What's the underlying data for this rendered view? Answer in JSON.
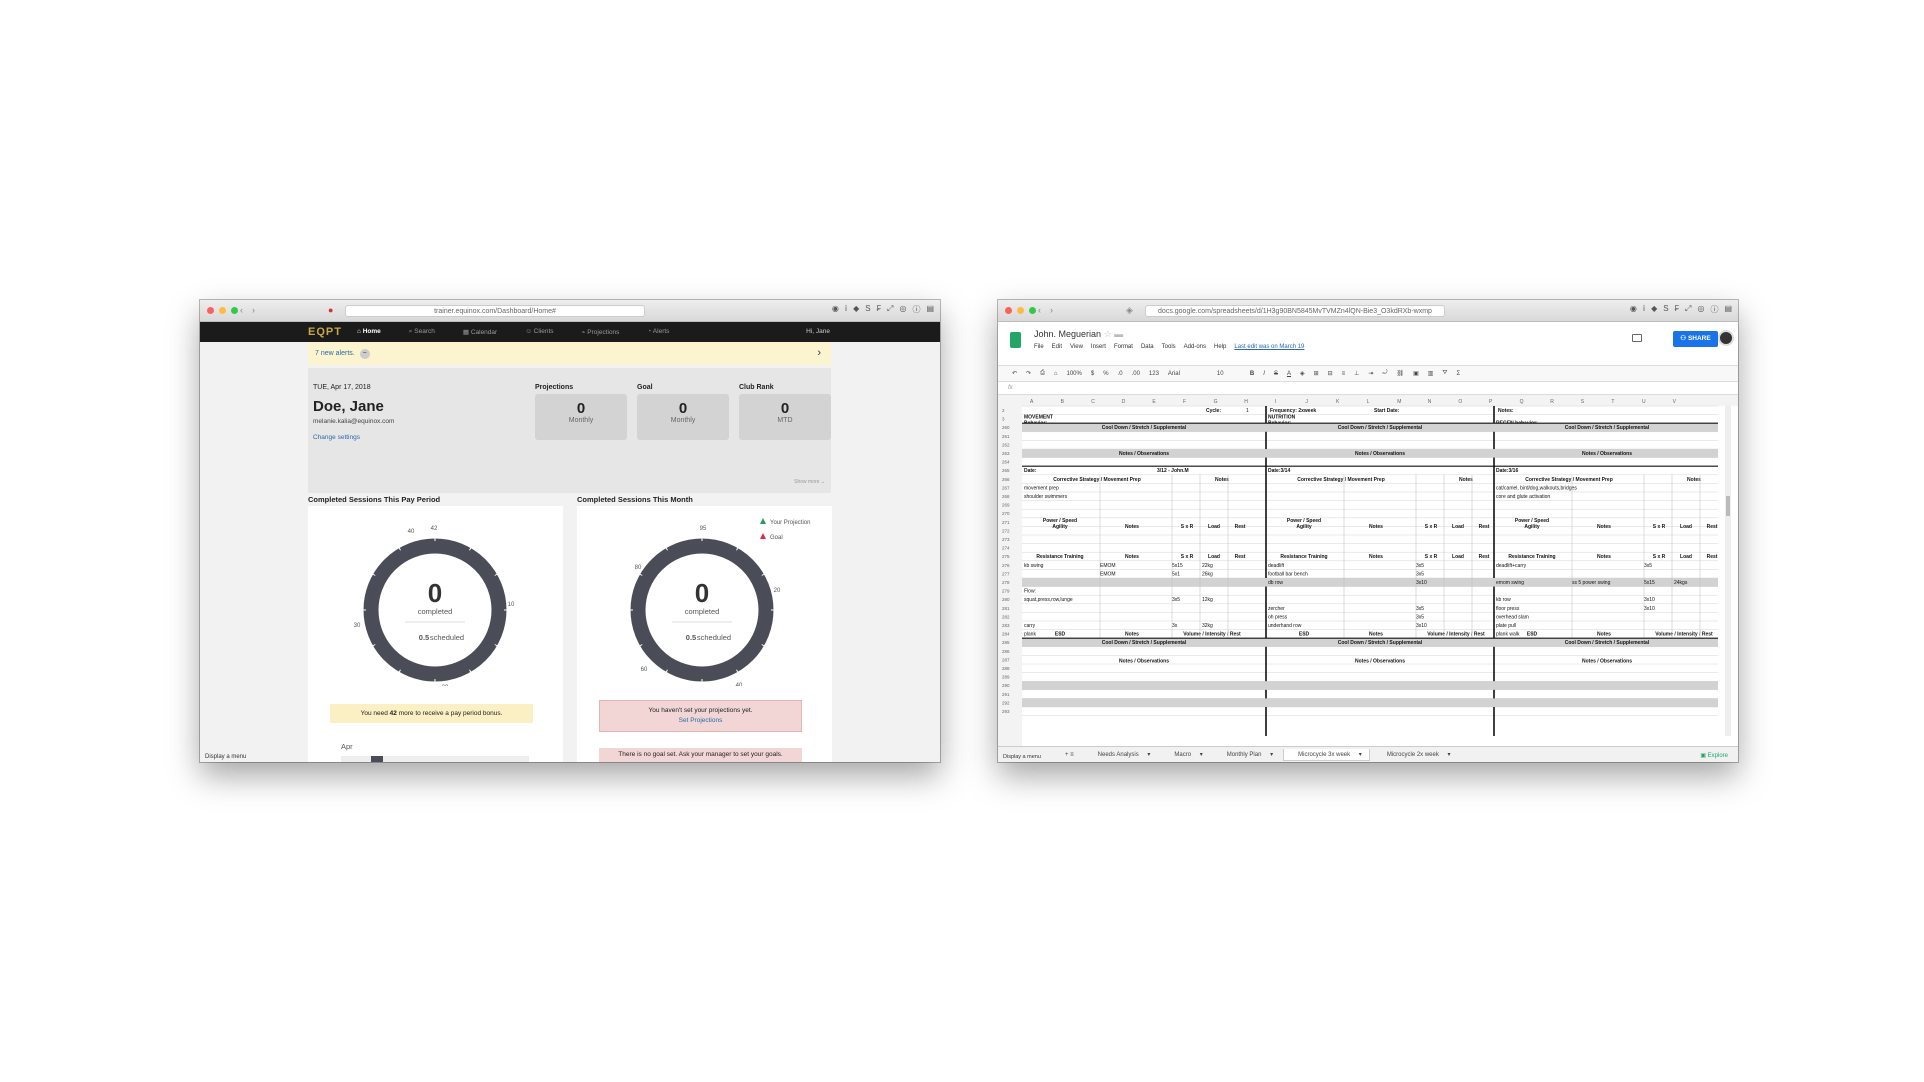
{
  "left_window": {
    "url": "trainer.equinox.com/Dashboard/Home#",
    "logo": "EQPT",
    "nav": [
      {
        "label": "Home",
        "active": true
      },
      {
        "label": "Search",
        "active": false
      },
      {
        "label": "Calendar",
        "active": false
      },
      {
        "label": "Clients",
        "active": false
      },
      {
        "label": "Projections",
        "active": false
      },
      {
        "label": "Alerts",
        "active": false
      }
    ],
    "greeting": "Hi, Jane",
    "alert": {
      "count": "7",
      "text": "new alerts."
    },
    "profile": {
      "date": "TUE, Apr 17, 2018",
      "name": "Doe, Jane",
      "email": "melanie.kalia@equinox.com",
      "change_settings": "Change settings"
    },
    "stats": [
      {
        "label": "Projections",
        "value": "0",
        "sub": "Monthly"
      },
      {
        "label": "Goal",
        "value": "0",
        "sub": "Monthly"
      },
      {
        "label": "Club Rank",
        "value": "0",
        "sub": "MTD"
      }
    ],
    "show_more": "Show more",
    "pay_period": {
      "title": "Completed Sessions This Pay Period",
      "count": "0",
      "completed_label": "completed",
      "scheduled_value": "0.5",
      "scheduled_label": "scheduled",
      "ticks": [
        "42",
        "40",
        "30",
        "20",
        "10"
      ],
      "note_pre": "You need",
      "note_num": "42",
      "note_post": "more to receive a pay period bonus.",
      "month_label": "Apr"
    },
    "month": {
      "title": "Completed Sessions This Month",
      "count": "0",
      "completed_label": "completed",
      "scheduled_value": "0.5",
      "scheduled_label": "scheduled",
      "ticks": [
        "95",
        "80",
        "60",
        "40",
        "20"
      ],
      "legend": [
        "Your Projection",
        "Goal"
      ],
      "note1": "You haven't set your projections yet.",
      "note1_link": "Set Projections",
      "note2": "There is no goal set. Ask your manager to set your goals."
    },
    "display_menu": "Display a menu"
  },
  "right_window": {
    "url": "docs.google.com/spreadsheets/d/1H3g90BN5845MvTVMZn4lQN-Bie3_O3kdRXb-wxmp",
    "doc_title": "John. Meguerian",
    "menu": [
      "File",
      "Edit",
      "View",
      "Insert",
      "Format",
      "Data",
      "Tools",
      "Add-ons",
      "Help"
    ],
    "last_edit": "Last edit was on March 19",
    "share": "SHARE",
    "toolbar": [
      "100%",
      "$",
      "%",
      ".0",
      ".00",
      "123",
      "Arial",
      "10",
      "B",
      "I",
      "S",
      "A"
    ],
    "fx": "fx",
    "columns": [
      "A",
      "B",
      "C",
      "D",
      "E",
      "F",
      "G",
      "H",
      "I",
      "J",
      "K",
      "L",
      "M",
      "N",
      "O",
      "P",
      "Q",
      "R",
      "S",
      "T",
      "U",
      "V"
    ],
    "row_numbers": [
      "2",
      "3",
      "260",
      "261",
      "262",
      "263",
      "264",
      "265",
      "266",
      "267",
      "268",
      "269",
      "270",
      "271",
      "272",
      "273",
      "274",
      "275",
      "276",
      "277",
      "278",
      "279",
      "280",
      "281",
      "282",
      "283",
      "284",
      "285",
      "286",
      "287",
      "288",
      "289",
      "290",
      "291",
      "292",
      "293"
    ],
    "header_row": {
      "cycle_label": "Cycle:",
      "cycle_value": "1",
      "frequency": "Frequency: 2xweek",
      "start_date": "Start Date:",
      "notes": "Notes:"
    },
    "behaviors": [
      "MOVEMENT\nBehavior:",
      "NUTRITION\nBehavior:",
      "REGEN behavior:"
    ],
    "section_cooldown": "Cool Down / Stretch / Supplemental",
    "section_notes": "Notes / Observations",
    "blocks": [
      {
        "date": "Date:",
        "date_extra": "3/12 - John.M",
        "corrective": [
          "movement prep",
          "shoulder swimmers"
        ],
        "resistance": [
          [
            "kb swing",
            "EMOM",
            "5x15",
            "22kg"
          ],
          [
            "",
            "EMOM",
            "5x1",
            "26kg"
          ],
          [
            "",
            "",
            "",
            ""
          ],
          [
            "Flow:",
            "",
            "",
            ""
          ],
          [
            "squat,press,row,lunge",
            "",
            "3x5",
            "12kg"
          ],
          [
            "",
            "",
            "",
            ""
          ],
          [
            "",
            "",
            "",
            ""
          ],
          [
            "carry",
            "",
            "3x",
            "32kg"
          ],
          [
            "plank",
            "",
            "",
            ""
          ]
        ]
      },
      {
        "date": "Date:3/14",
        "date_extra": "",
        "corrective": [
          "",
          ""
        ],
        "resistance": [
          [
            "deadlift",
            "",
            "3x5",
            ""
          ],
          [
            "football bar bench",
            "",
            "3x5",
            ""
          ],
          [
            "db row",
            "",
            "3x10",
            ""
          ],
          [
            "",
            "",
            "",
            ""
          ],
          [
            "",
            "",
            "",
            ""
          ],
          [
            "zercher",
            "",
            "3x5",
            ""
          ],
          [
            "oh press",
            "",
            "3x5",
            ""
          ],
          [
            "underhand row",
            "",
            "3x10",
            ""
          ],
          [
            "",
            "",
            "",
            ""
          ]
        ]
      },
      {
        "date": "Date:3/16",
        "date_extra": "",
        "corrective": [
          "cat/camel, bird/dog,walkouts,bridges",
          "core and glute activation"
        ],
        "resistance": [
          [
            "deadlift+carry",
            "",
            "3x5",
            ""
          ],
          [
            "",
            "",
            "",
            ""
          ],
          [
            "emom swing",
            "ss 5 power swing",
            "5x15",
            "24kgs"
          ],
          [
            "",
            "",
            "",
            ""
          ],
          [
            "kb row",
            "",
            "3x10",
            ""
          ],
          [
            "floor press",
            "",
            "3x10",
            ""
          ],
          [
            "overhead slam",
            "",
            "",
            ""
          ],
          [
            "plate pull",
            "",
            "",
            ""
          ],
          [
            "plank walk",
            "",
            "",
            ""
          ]
        ]
      }
    ],
    "headers": {
      "corrective": "Corrective Strategy / Movement Prep",
      "notes": "Notes",
      "power": "Power / Speed\nAgility",
      "sxr": "S x R",
      "load": "Load",
      "rest": "Rest",
      "resistance": "Resistance Training",
      "esd": "ESD",
      "vir": "Volume / Intensity / Rest"
    },
    "sheet_tabs": [
      {
        "label": "Needs Analysis",
        "active": false
      },
      {
        "label": "Macro",
        "active": false
      },
      {
        "label": "Monthly Plan",
        "active": false
      },
      {
        "label": "Microcycle 3x  week",
        "active": true
      },
      {
        "label": "Microcycle 2x  week",
        "active": false
      }
    ],
    "explore": "Explore",
    "display_menu": "Display a menu"
  },
  "colors": {
    "equinox_gold": "#c8a64a",
    "donut": "#4a4d57",
    "sheets_green": "#23a566",
    "share_blue": "#1a73e8",
    "alert_yellow": "#fbf4cf",
    "warn_pink": "#f2d6d6",
    "note_yellow": "#fbefc4"
  }
}
